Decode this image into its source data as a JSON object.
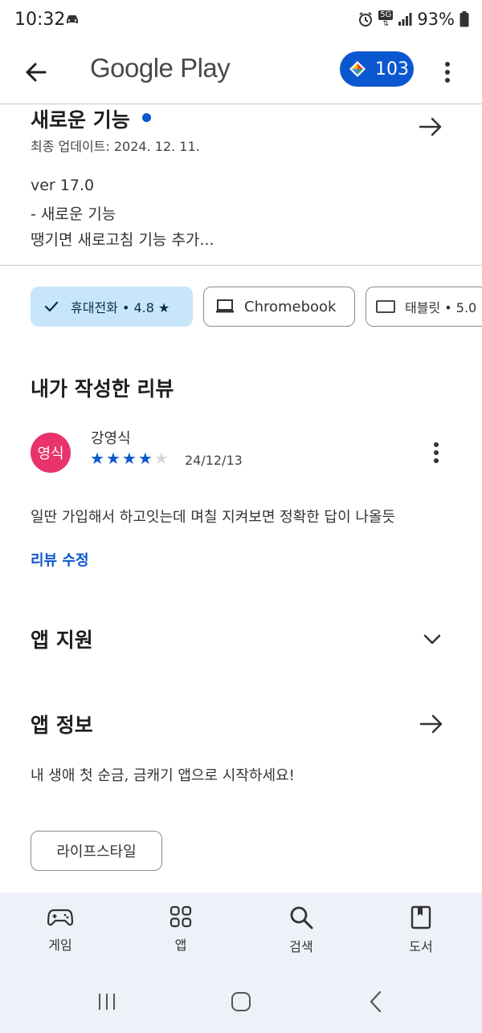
{
  "status_bar": {
    "time": "10:32",
    "network_badge": "5G",
    "battery": "93%"
  },
  "app_bar": {
    "brand": "Google Play",
    "points": "103"
  },
  "whats_new": {
    "title": "새로운 기능",
    "last_updated": "최종 업데이트: 2024. 12. 11.",
    "notes": [
      "ver 17.0",
      "- 새로운 기능",
      "땡기면 새로고침 기능 추가..."
    ]
  },
  "device_chips": {
    "phone": "휴대전화 • 4.8 ★",
    "chromebook": "Chromebook",
    "tablet": "태블릿 • 5.0"
  },
  "my_review": {
    "heading": "내가 작성한 리뷰",
    "avatar_text": "영식",
    "reviewer": "강영식",
    "rating": 4,
    "rating_max": 5,
    "date": "24/12/13",
    "text": "일딴 가입해서 하고잇는데 며칠 지켜보면 정확한 답이 나올듯",
    "edit_label": "리뷰 수정"
  },
  "app_support": {
    "heading": "앱 지원"
  },
  "app_info": {
    "heading": "앱 정보",
    "description": "내 생애 첫 순금, 금캐기 앱으로 시작하세요!",
    "category": "라이프스타일"
  },
  "bottom_nav": {
    "games": "게임",
    "apps": "앱",
    "search": "검색",
    "books": "도서"
  },
  "colors": {
    "accent": "#0b57d0",
    "chip_selected": "#c7e6fa",
    "avatar": "#e8336c",
    "nav_background": "#eef2f8"
  }
}
